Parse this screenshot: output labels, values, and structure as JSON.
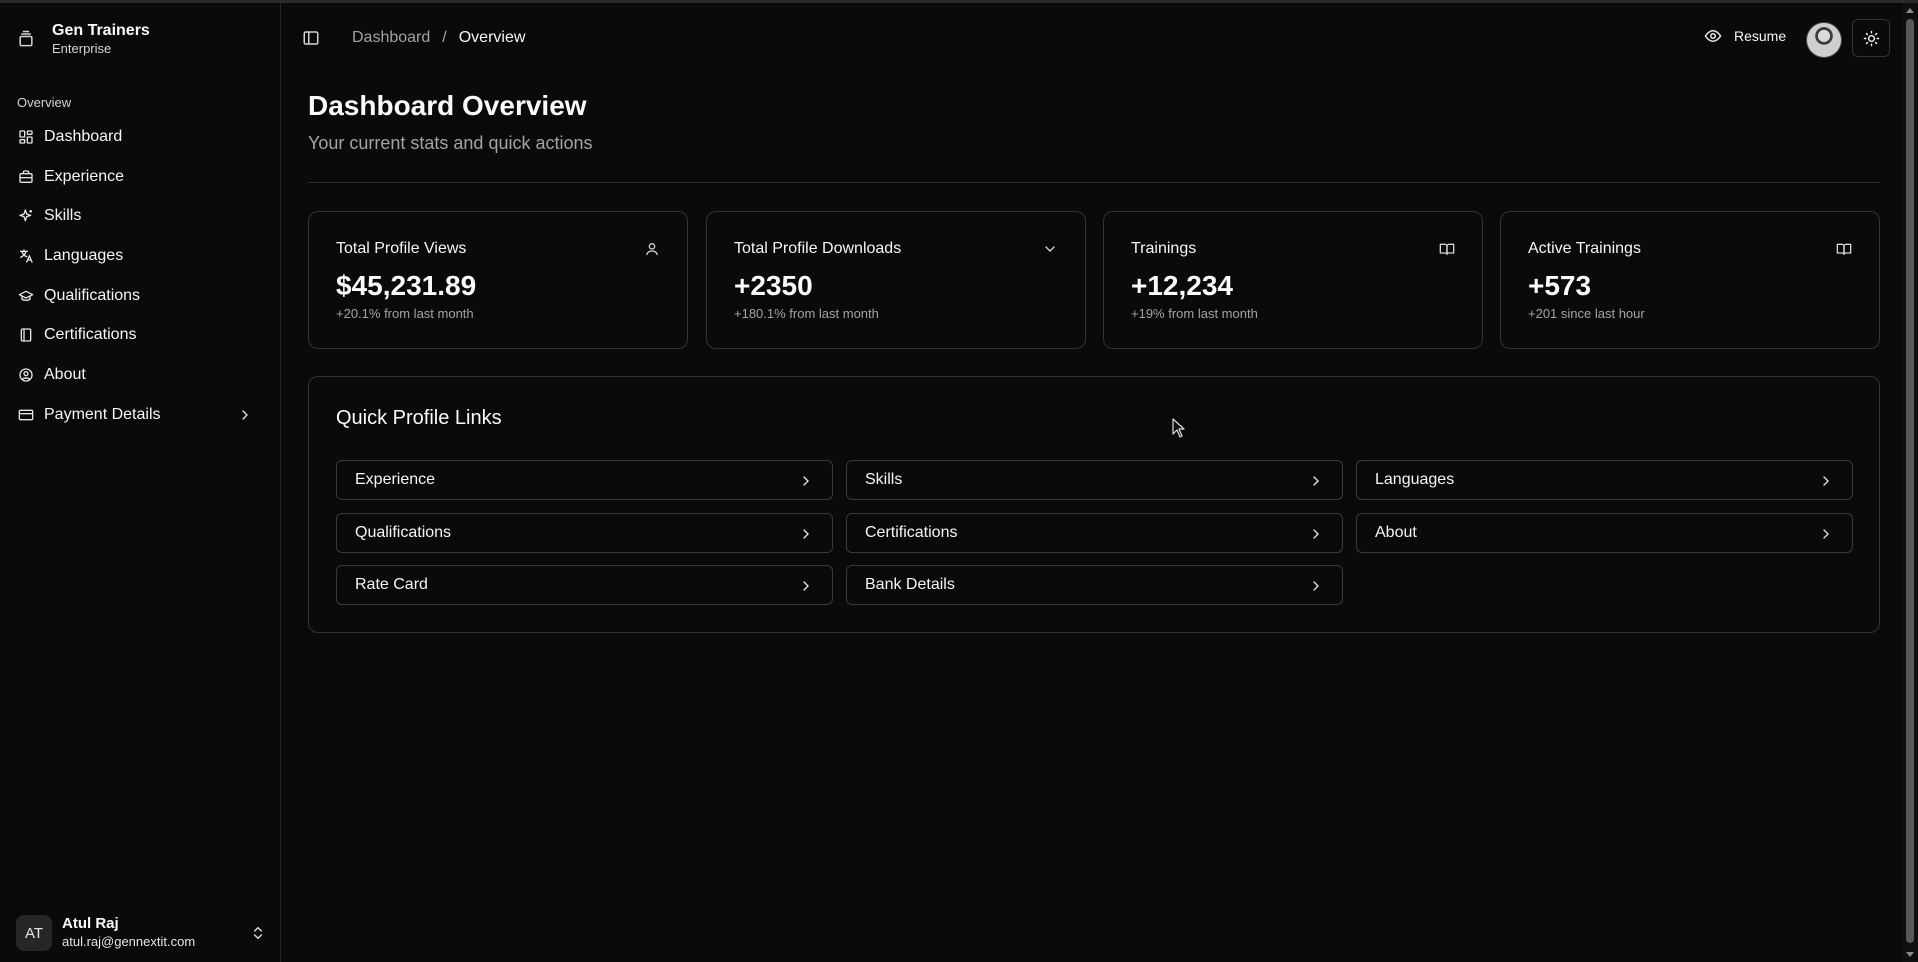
{
  "sidebar": {
    "brand": {
      "name": "Gen Trainers",
      "plan": "Enterprise"
    },
    "group_label": "Overview",
    "items": [
      {
        "label": "Dashboard",
        "icon": "dashboard-grid-icon"
      },
      {
        "label": "Experience",
        "icon": "briefcase-icon"
      },
      {
        "label": "Skills",
        "icon": "sparkles-icon"
      },
      {
        "label": "Languages",
        "icon": "languages-icon"
      },
      {
        "label": "Qualifications",
        "icon": "graduation-cap-icon"
      },
      {
        "label": "Certifications",
        "icon": "book-icon"
      },
      {
        "label": "About",
        "icon": "user-circle-icon"
      },
      {
        "label": "Payment Details",
        "icon": "credit-card-icon"
      }
    ],
    "user": {
      "initials": "AT",
      "name": "Atul Raj",
      "email": "atul.raj@gennextit.com"
    }
  },
  "header": {
    "breadcrumb": {
      "parent": "Dashboard",
      "separator": "/",
      "current": "Overview"
    },
    "resume_label": "Resume"
  },
  "main": {
    "title": "Dashboard Overview",
    "subtitle": "Your current stats and quick actions",
    "stats": [
      {
        "label": "Total Profile Views",
        "value": "$45,231.89",
        "delta": "+20.1% from last month",
        "icon": "user-icon"
      },
      {
        "label": "Total Profile Downloads",
        "value": "+2350",
        "delta": "+180.1% from last month",
        "icon": "chevron-down-icon"
      },
      {
        "label": "Trainings",
        "value": "+12,234",
        "delta": "+19% from last month",
        "icon": "open-book-icon"
      },
      {
        "label": "Active Trainings",
        "value": "+573",
        "delta": "+201 since last hour",
        "icon": "open-book-icon"
      }
    ],
    "quick_links": {
      "title": "Quick Profile Links",
      "links": [
        "Experience",
        "Skills",
        "Languages",
        "Qualifications",
        "Certifications",
        "About",
        "Rate Card",
        "Bank Details"
      ]
    }
  },
  "colors": {
    "background": "#0a0a0a",
    "border": "#333333",
    "text": "#fafafa",
    "muted": "#a3a3a3"
  }
}
